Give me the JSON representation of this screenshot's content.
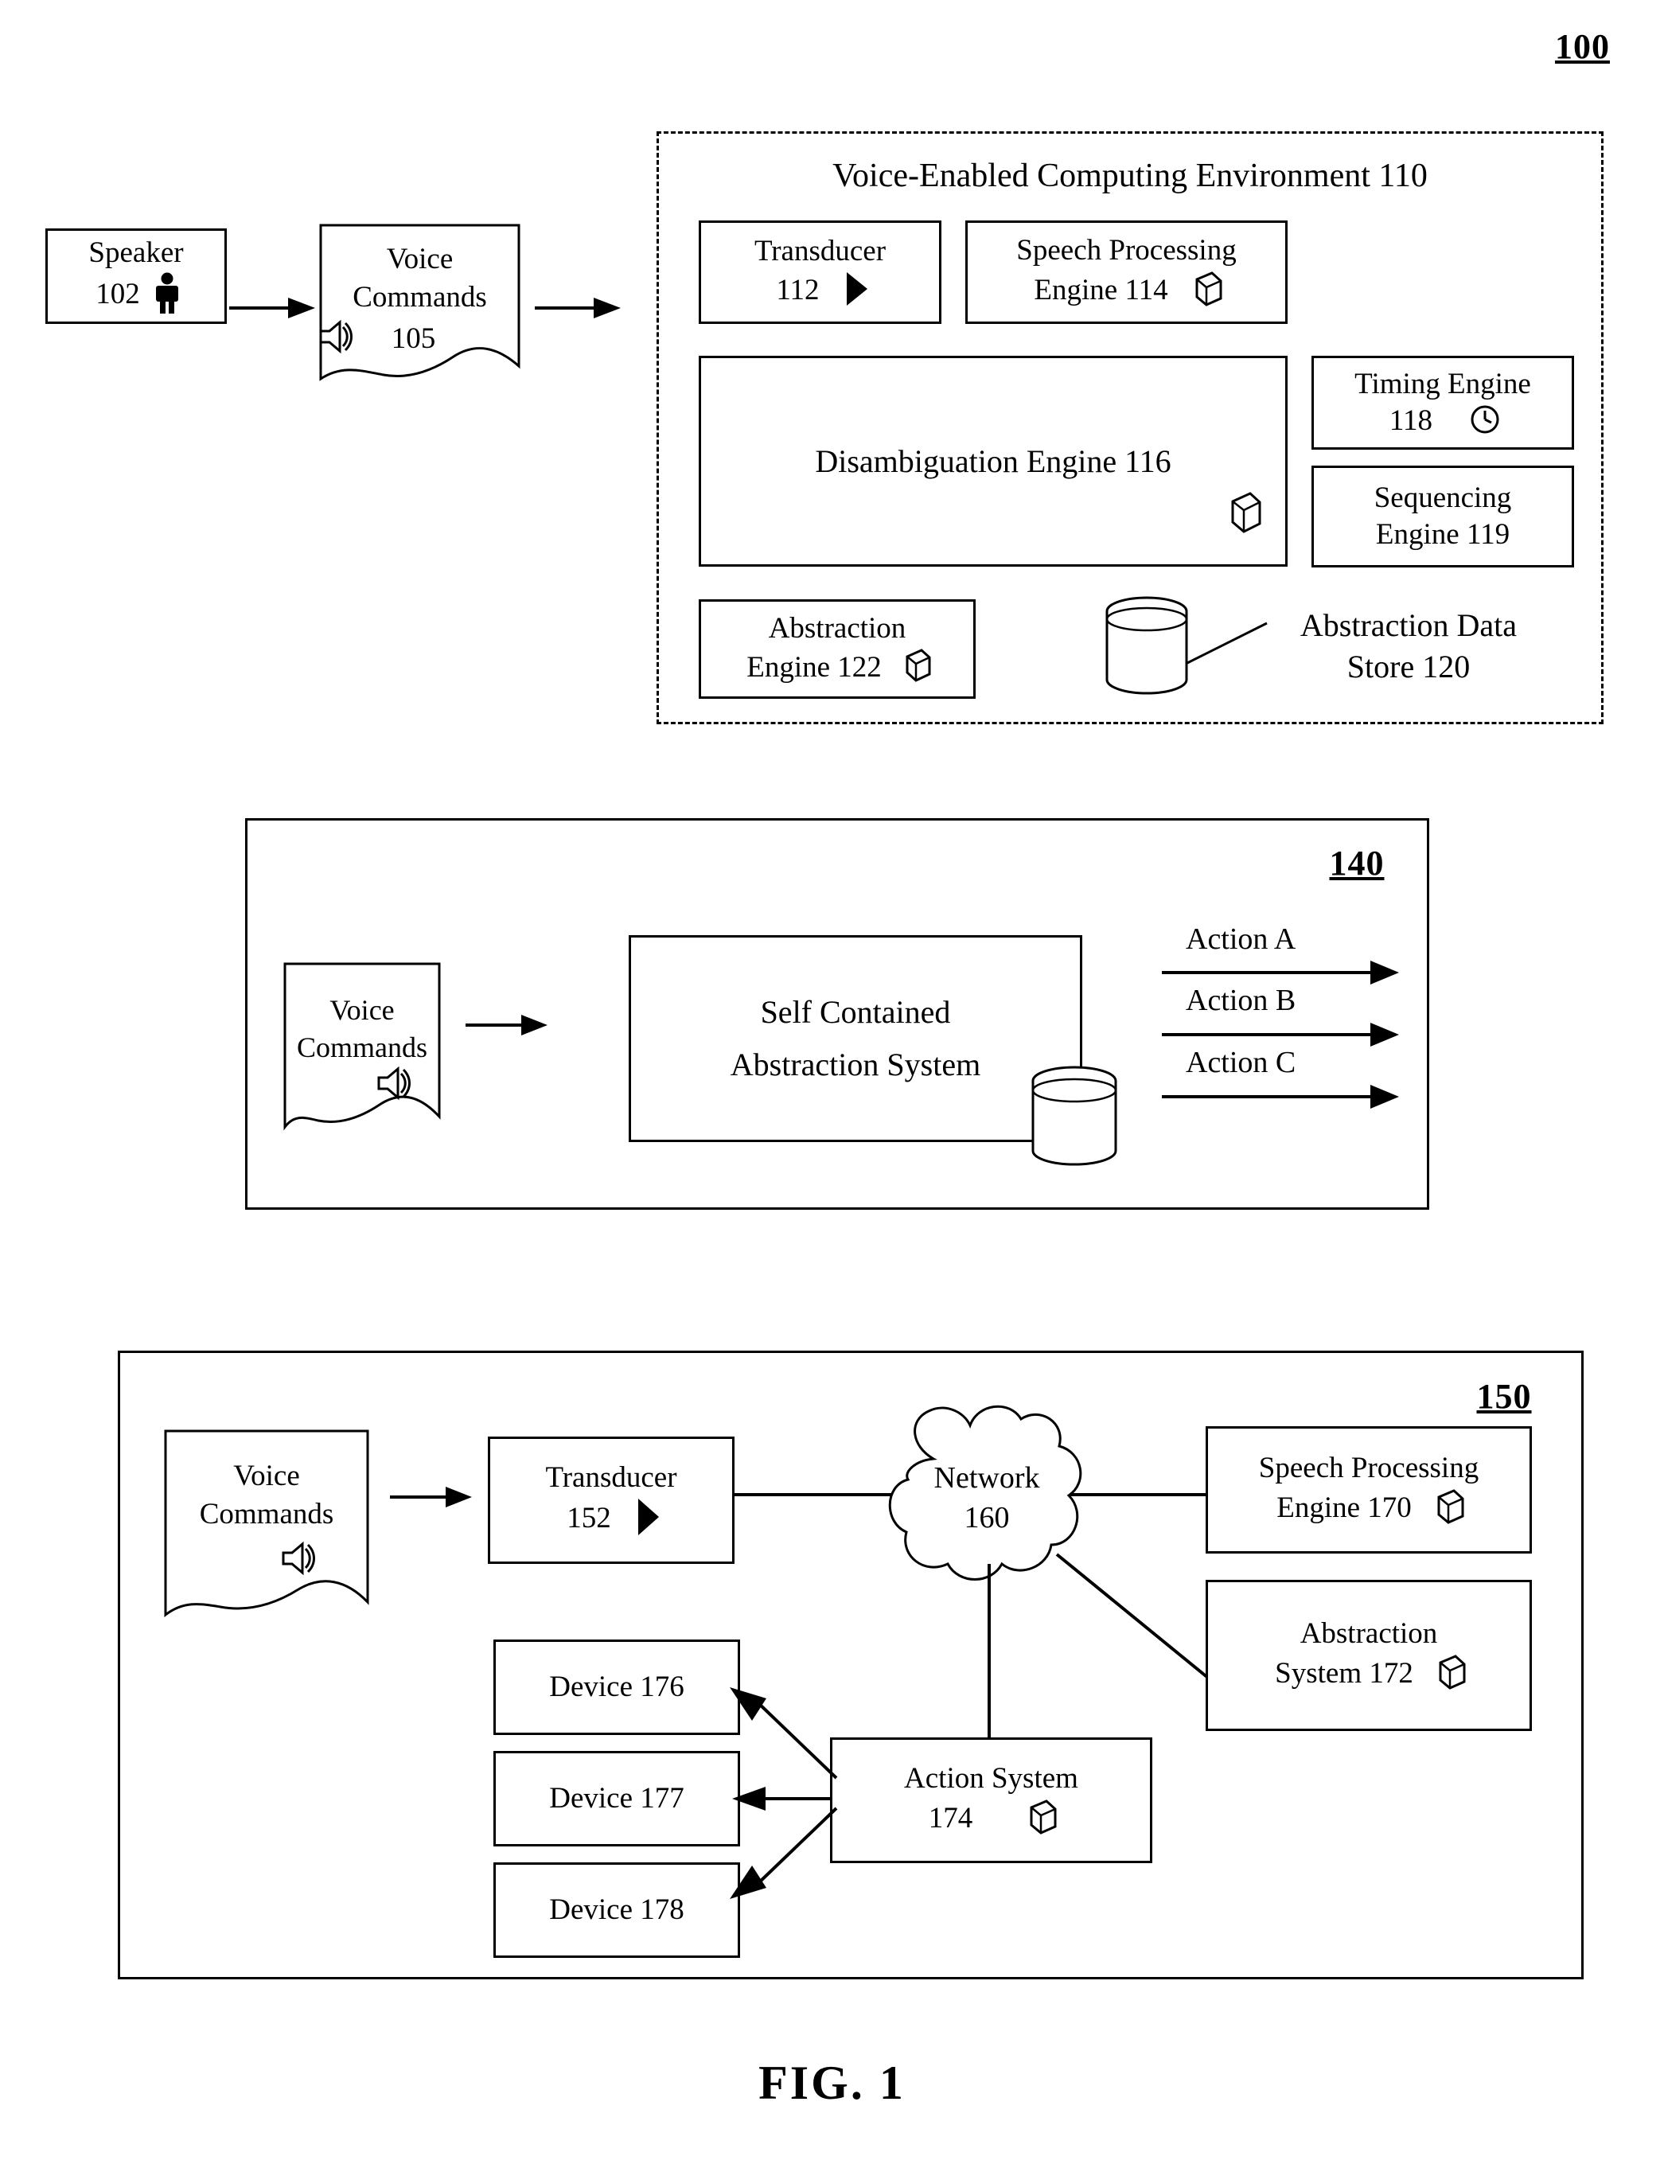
{
  "figure": {
    "number_label": "100",
    "caption": "FIG. 1"
  },
  "top_section": {
    "speaker_box": {
      "line1": "Speaker",
      "line2": "102",
      "icon": "person-icon"
    },
    "voice_commands": {
      "line1": "Voice",
      "line2": "Commands",
      "line3": "105",
      "icon": "speaker-audio-icon"
    },
    "environment": {
      "title": "Voice-Enabled Computing Environment 110",
      "transducer": {
        "line1": "Transducer",
        "line2": "112",
        "icon": "play-triangle-icon"
      },
      "speech_processing_engine": {
        "line1": "Speech Processing",
        "line2": "Engine 114",
        "icon": "cube-icon"
      },
      "disambiguation_engine": {
        "label": "Disambiguation Engine 116",
        "icon": "cube-icon"
      },
      "timing_engine": {
        "line1": "Timing Engine",
        "line2": "118",
        "icon": "clock-icon"
      },
      "sequencing_engine": {
        "line1": "Sequencing",
        "line2": "Engine 119"
      },
      "abstraction_engine": {
        "line1": "Abstraction",
        "line2": "Engine 122",
        "icon": "cube-icon"
      },
      "abstraction_data_store": {
        "line1": "Abstraction Data",
        "line2": "Store 120",
        "icon": "database-cylinder-icon"
      }
    }
  },
  "middle_section": {
    "number_label": "140",
    "voice_commands": {
      "line1": "Voice",
      "line2": "Commands",
      "icon": "speaker-audio-icon"
    },
    "abstraction_system": {
      "line1": "Self Contained",
      "line2": "Abstraction System",
      "icon": "database-cylinder-icon"
    },
    "actions": [
      "Action A",
      "Action B",
      "Action C"
    ]
  },
  "bottom_section": {
    "number_label": "150",
    "voice_commands": {
      "line1": "Voice",
      "line2": "Commands",
      "icon": "speaker-audio-icon"
    },
    "transducer": {
      "line1": "Transducer",
      "line2": "152",
      "icon": "play-triangle-icon"
    },
    "network": {
      "line1": "Network",
      "line2": "160",
      "icon": "cloud-icon"
    },
    "speech_processing_engine": {
      "line1": "Speech Processing",
      "line2": "Engine 170",
      "icon": "cube-icon"
    },
    "abstraction_system": {
      "line1": "Abstraction",
      "line2": "System 172",
      "icon": "cube-icon"
    },
    "action_system": {
      "line1": "Action System",
      "line2": "174",
      "icon": "cube-icon"
    },
    "devices": [
      "Device 176",
      "Device 177",
      "Device 178"
    ]
  },
  "colors": {
    "ink": "#000000",
    "paper": "#ffffff"
  }
}
